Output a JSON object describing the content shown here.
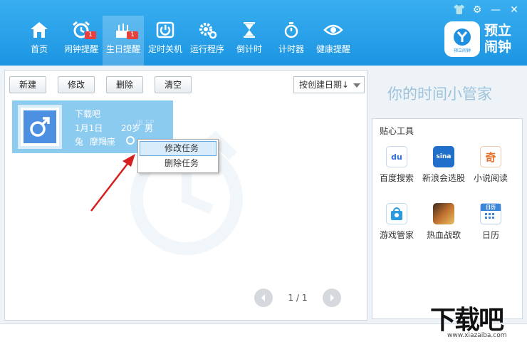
{
  "nav": {
    "items": [
      {
        "label": "首页",
        "icon": "home-icon"
      },
      {
        "label": "闹钟提醒",
        "icon": "alarm-clock-icon",
        "badge": "1"
      },
      {
        "label": "生日提醒",
        "icon": "birthday-cake-icon",
        "badge": "1",
        "active": true
      },
      {
        "label": "定时关机",
        "icon": "power-icon"
      },
      {
        "label": "运行程序",
        "icon": "gear-icon"
      },
      {
        "label": "倒计时",
        "icon": "hourglass-icon"
      },
      {
        "label": "计时器",
        "icon": "stopwatch-icon"
      },
      {
        "label": "健康提醒",
        "icon": "eye-icon"
      }
    ]
  },
  "brand": {
    "line1": "预立",
    "line2": "闹钟",
    "logo_caption": "预立闹钟"
  },
  "toolbar": {
    "new_label": "新建",
    "edit_label": "修改",
    "delete_label": "删除",
    "clear_label": "清空",
    "sort_label": "按创建日期↓"
  },
  "card": {
    "name": "下载吧",
    "date": "1月1日",
    "age": "20岁",
    "gender": "男",
    "zodiac": "兔",
    "constellation": "摩羯座",
    "watermark": "JB.SP"
  },
  "context_menu": {
    "edit_task": "修改任务",
    "delete_task": "删除任务"
  },
  "pager": {
    "text": "1 / 1"
  },
  "slogan": "你的时间小管家",
  "tools": {
    "title": "贴心工具",
    "items": [
      {
        "label": "百度搜索",
        "icon": "baidu-icon",
        "glyph": "du",
        "color": "#2f6fd6"
      },
      {
        "label": "新浪会选股",
        "icon": "sina-icon",
        "glyph": "sina",
        "color": "#1f6fcb"
      },
      {
        "label": "小说阅读",
        "icon": "novel-icon",
        "glyph": "奇",
        "color": "#e8702a"
      },
      {
        "label": "游戏管家",
        "icon": "game-bag-icon",
        "glyph": "",
        "color": "#2a9be0"
      },
      {
        "label": "热血战歌",
        "icon": "game-art-icon",
        "glyph": "",
        "color": "#a05528"
      },
      {
        "label": "日历",
        "icon": "calendar-icon",
        "glyph": "日历",
        "color": "#3a86d8"
      }
    ]
  },
  "site_logo": {
    "main": "下载吧",
    "url": "www.xiazaiba.com"
  },
  "colors": {
    "topbar": "#2aa3ec",
    "card": "#8ccbf0",
    "badge": "#e8413d"
  }
}
